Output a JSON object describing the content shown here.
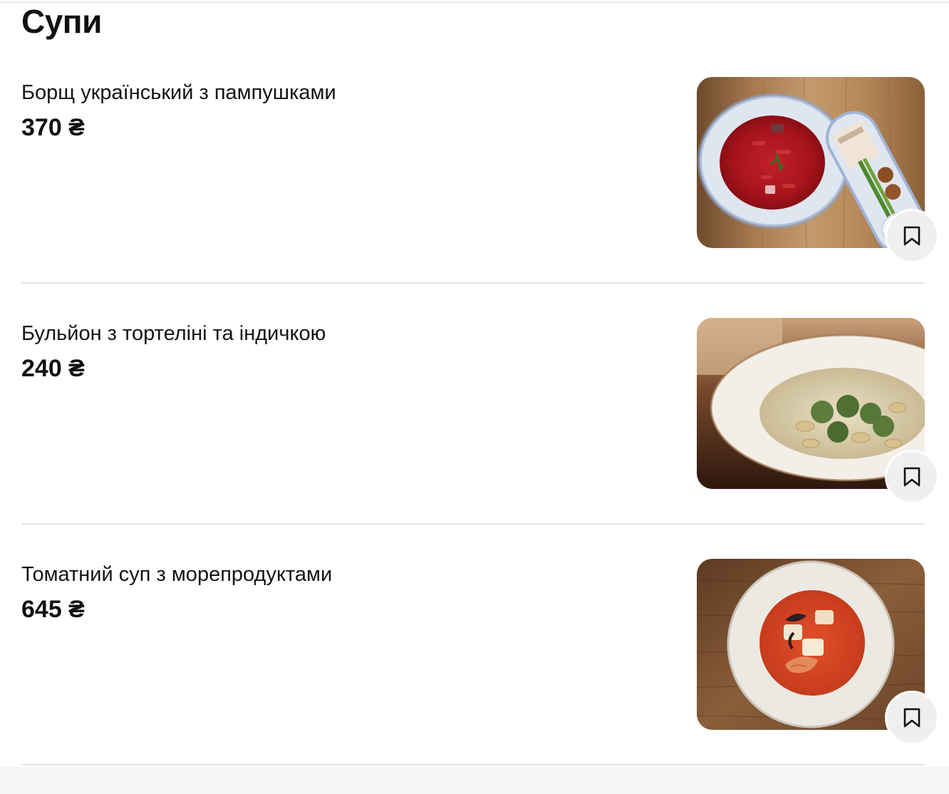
{
  "section": {
    "title": "Супи"
  },
  "items": [
    {
      "name": "Борщ український з пампушками",
      "price": "370 ₴",
      "photo_icon": "borscht-photo",
      "bookmark_icon": "bookmark-icon"
    },
    {
      "name": "Бульйон з тортеліні та індичкою",
      "price": "240 ₴",
      "photo_icon": "tortellini-broth-photo",
      "bookmark_icon": "bookmark-icon"
    },
    {
      "name": "Томатний суп з морепродуктами",
      "price": "645 ₴",
      "photo_icon": "seafood-tomato-soup-photo",
      "bookmark_icon": "bookmark-icon"
    }
  ],
  "colors": {
    "text": "#111111",
    "divider": "#e4e4e4",
    "bookmark_bg": "#efefef"
  }
}
